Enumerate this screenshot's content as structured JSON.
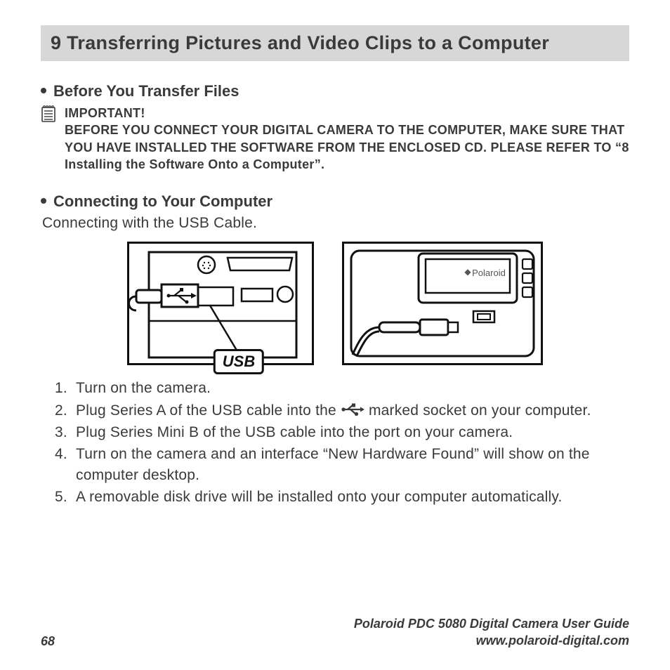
{
  "chapter": {
    "title": "9 Transferring Pictures and Video Clips to a Computer"
  },
  "section1": {
    "heading": "Before You Transfer Files",
    "important_label": "IMPORTANT!",
    "important_body": "BEFORE YOU CONNECT YOUR DIGITAL CAMERA TO THE COMPUTER, MAKE SURE THAT YOU HAVE INSTALLED THE SOFTWARE FROM THE ENCLOSED CD. PLEASE REFER TO “8 Installing the Software Onto a Computer”."
  },
  "section2": {
    "heading": "Connecting to Your Computer",
    "sub": "Connecting with the USB Cable."
  },
  "figures": {
    "usb_label": "USB",
    "brand_label": "Polaroid"
  },
  "steps": {
    "s1": "Turn on the camera.",
    "s2a": "Plug Series A of the USB cable into the ",
    "s2b": " marked socket on your computer.",
    "s3": "Plug Series Mini B of the USB cable into the port on your camera.",
    "s4": "Turn on the camera and an interface “New Hardware Found” will show on the computer desktop.",
    "s5": "A removable disk drive will be installed onto your computer automatically."
  },
  "footer": {
    "page": "68",
    "guide": "Polaroid PDC 5080 Digital Camera User Guide",
    "url": "www.polaroid-digital.com"
  }
}
